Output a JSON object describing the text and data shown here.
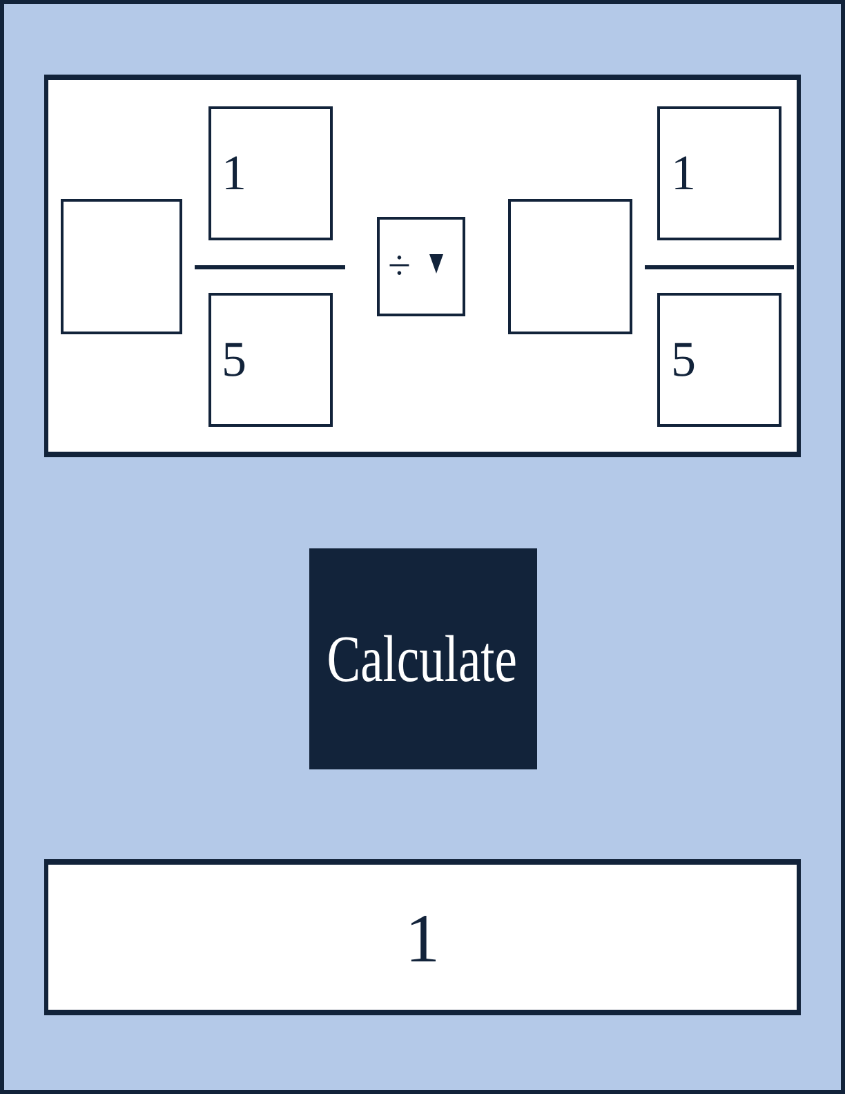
{
  "expression": [
    {
      "kind": "fraction",
      "numerator": "1",
      "denominator": "5"
    },
    {
      "kind": "operator",
      "value": "÷"
    },
    {
      "kind": "fraction",
      "numerator": "1",
      "denominator": "5"
    }
  ],
  "calculate_button": {
    "label": "Calculate"
  },
  "result": {
    "value": "1"
  }
}
